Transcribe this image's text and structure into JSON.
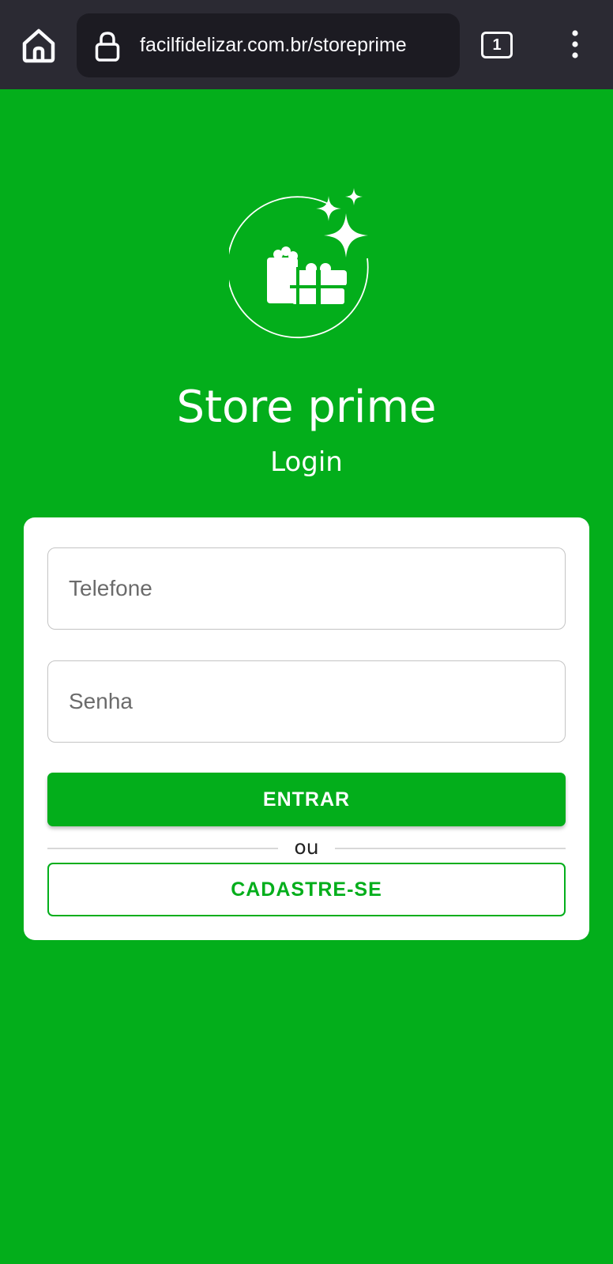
{
  "browser": {
    "url": "facilfidelizar.com.br/storeprime",
    "tab_count": "1",
    "toolbar_color": "#2b2a33"
  },
  "icons": {
    "home": "home-icon",
    "lock": "lock-icon",
    "tabs": "tabs-icon",
    "menu": "kebab-menu-icon",
    "logo": "gift-sparkles-icon"
  },
  "theme": {
    "background": "#03ae1b",
    "card": "#ffffff",
    "accent": "#03ae1b"
  },
  "header": {
    "title": "Store prime",
    "subtitle": "Login"
  },
  "form": {
    "phone_placeholder": "Telefone",
    "password_placeholder": "Senha",
    "submit_label": "ENTRAR",
    "separator_label": "ou",
    "register_label": "CADASTRE-SE"
  }
}
